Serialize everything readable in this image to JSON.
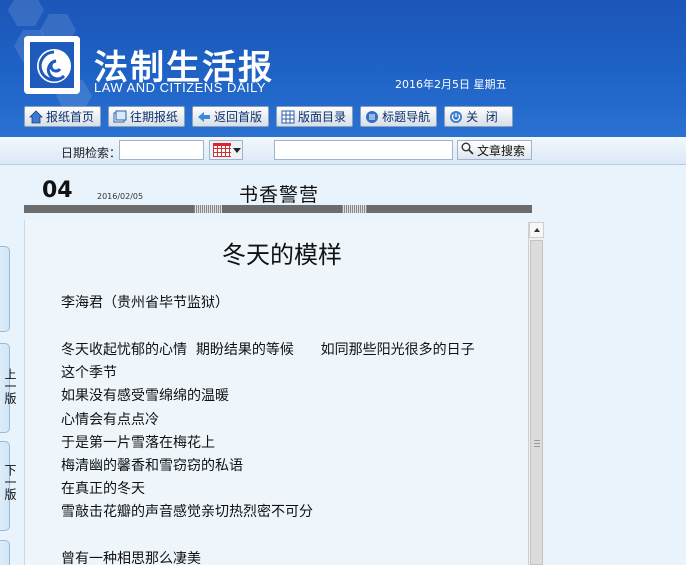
{
  "header": {
    "title": "法制生活报",
    "subtitle": "LAW AND CITIZENS DAILY",
    "date": "2016年2月5日  星期五"
  },
  "nav": [
    {
      "label": "报纸首页",
      "icon": "home-icon"
    },
    {
      "label": "往期报纸",
      "icon": "archive-icon"
    },
    {
      "label": "返回首版",
      "icon": "return-icon"
    },
    {
      "label": "版面目录",
      "icon": "grid-icon"
    },
    {
      "label": "标题导航",
      "icon": "list-icon"
    },
    {
      "label": "关  闭",
      "icon": "power-icon"
    }
  ],
  "search": {
    "date_label": "日期检索：",
    "date_value": "",
    "keyword_value": "",
    "button_label": "文章搜索"
  },
  "page": {
    "number": "04",
    "date": "2016/02/05",
    "name": "书香警营"
  },
  "article": {
    "title": "冬天的模样",
    "author": "李海君（贵州省毕节监狱）",
    "lines": [
      "冬天收起忧郁的心情  期盼结果的等候      如同那些阳光很多的日子",
      "这个季节",
      "如果没有感受雪绵绵的温暖",
      "心情会有点点冷",
      "于是第一片雪落在梅花上",
      "梅清幽的馨香和雪窃窃的私语",
      "在真正的冬天",
      "雪敲击花瓣的声音感觉亲切热烈密不可分",
      "",
      "曾有一种相思那么凄美"
    ]
  },
  "side_tabs": [
    "上一版",
    "下一版"
  ],
  "colors": {
    "header_blue": "#1f63c6",
    "content_bg": "#eef6fc"
  }
}
